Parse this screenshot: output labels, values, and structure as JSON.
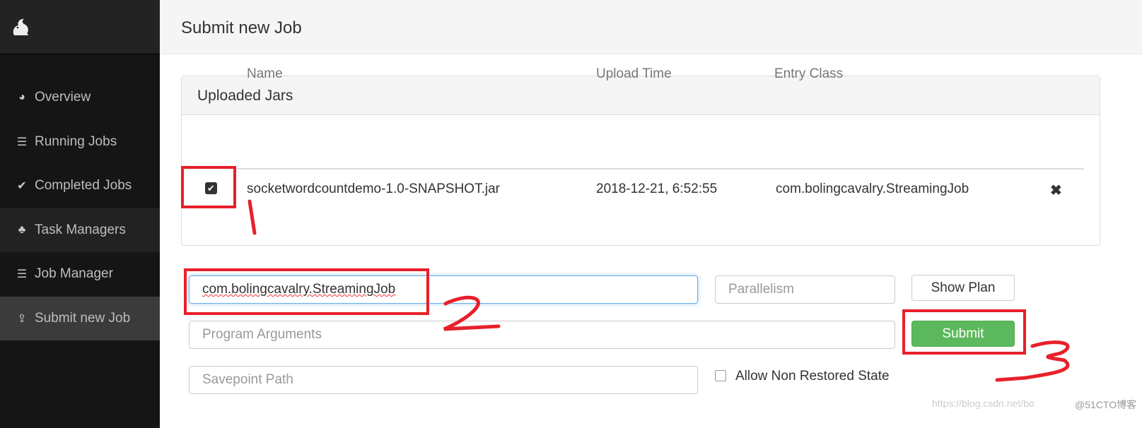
{
  "sidebar": {
    "items": [
      {
        "label": "Overview",
        "icon": "dashboard-icon"
      },
      {
        "label": "Running Jobs",
        "icon": "tasks-icon"
      },
      {
        "label": "Completed Jobs",
        "icon": "check-circle-icon"
      },
      {
        "label": "Task Managers",
        "icon": "sitemap-icon"
      },
      {
        "label": "Job Manager",
        "icon": "server-icon"
      },
      {
        "label": "Submit new Job",
        "icon": "upload-icon"
      }
    ]
  },
  "header": {
    "title": "Submit new Job"
  },
  "jars": {
    "title": "Uploaded Jars",
    "columns": [
      "Name",
      "Upload Time",
      "Entry Class"
    ],
    "rows": [
      {
        "name": "socketwordcountdemo-1.0-SNAPSHOT.jar",
        "upload_time": "2018-12-21, 6:52:55",
        "entry_class": "com.bolingcavalry.StreamingJob",
        "selected": true
      }
    ]
  },
  "form": {
    "entry_class_value": "com.bolingcavalry.StreamingJob",
    "parallelism_placeholder": "Parallelism",
    "program_args_placeholder": "Program Arguments",
    "savepoint_placeholder": "Savepoint Path",
    "allow_non_restored_label": "Allow Non Restored State",
    "allow_non_restored_checked": false,
    "show_plan_label": "Show Plan",
    "submit_label": "Submit"
  },
  "annotations": [
    "1",
    "2",
    "3"
  ],
  "watermark": {
    "url": "https://blog.csdn.net/bo",
    "site": "@51CTO博客"
  },
  "colors": {
    "annotation": "#e8202a",
    "submit": "#5cb85c"
  }
}
